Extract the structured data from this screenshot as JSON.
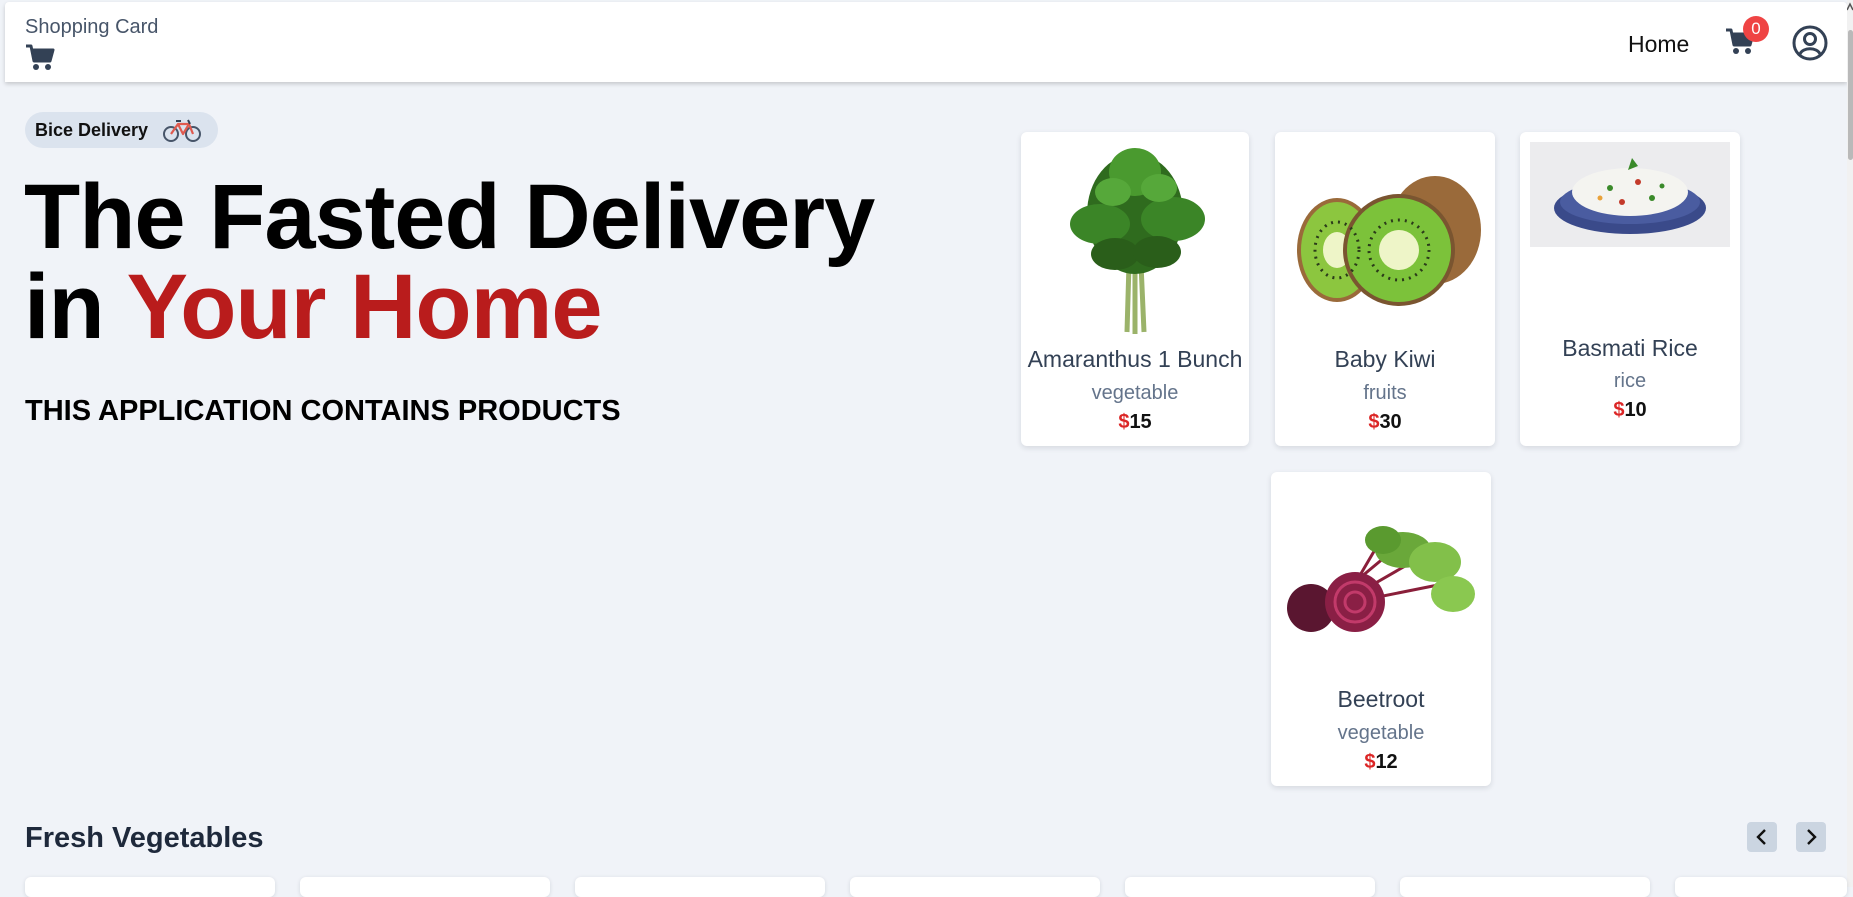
{
  "header": {
    "brand": "Shopping Card",
    "brand_icon": "cart-icon",
    "nav_home": "Home",
    "cart_count": "0",
    "cart_icon": "cart-icon",
    "profile_icon": "user-circle-icon"
  },
  "hero": {
    "badge": "Bice Delivery",
    "badge_icon": "bicycle-icon",
    "headline_line1": "The Fasted Delivery",
    "headline_line2_prefix": "in ",
    "headline_line2_accent": "Your Home",
    "tagline": "THIS APPLICATION CONTAINS PRODUCTS"
  },
  "products": [
    {
      "name": "Amaranthus 1 Bunch",
      "category": "vegetable",
      "currency": "$",
      "price": "15"
    },
    {
      "name": "Baby Kiwi",
      "category": "fruits",
      "currency": "$",
      "price": "30"
    },
    {
      "name": "Basmati Rice",
      "category": "rice",
      "currency": "$",
      "price": "10"
    },
    {
      "name": "Beetroot",
      "category": "vegetable",
      "currency": "$",
      "price": "12"
    }
  ],
  "section": {
    "title": "Fresh Vegetables",
    "prev_icon": "chevron-left-icon",
    "next_icon": "chevron-right-icon"
  },
  "colors": {
    "background": "#f0f3f8",
    "accent_red": "#b91c1c",
    "badge_bg": "#dbe3ee",
    "cart_badge": "#ef4444"
  }
}
